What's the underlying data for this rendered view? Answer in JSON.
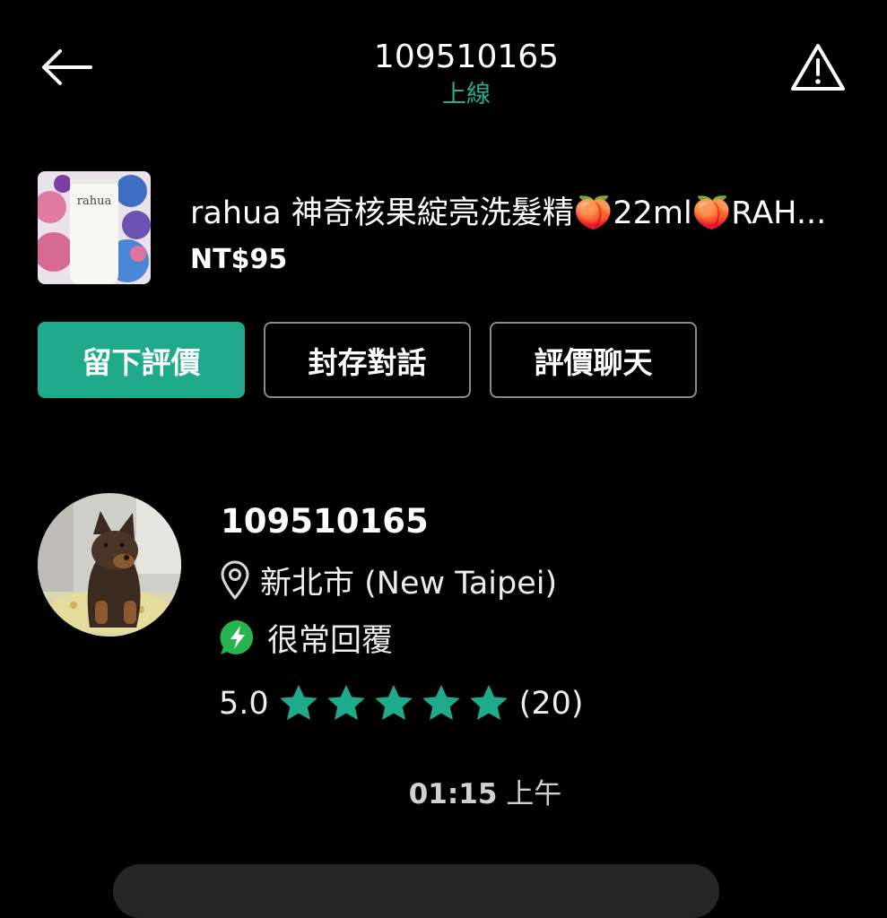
{
  "colors": {
    "accent": "#1faa8c",
    "background": "#000000",
    "outline": "#8a8a8a",
    "online_status": "#2bab8e"
  },
  "header": {
    "back_icon": "arrow-left-icon",
    "title": "109510165",
    "status": "上線",
    "report_icon": "warning-triangle-icon"
  },
  "listing": {
    "title": "rahua 神奇核果綻亮洗髮精🍑22ml🍑RAH...",
    "price": "NT$95",
    "thumbnail_brand": "rahua"
  },
  "actions": {
    "leave_review": "留下評價",
    "archive_chat": "封存對話",
    "rate_chat": "評價聊天"
  },
  "profile": {
    "name": "109510165",
    "location_icon": "map-pin-icon",
    "location": "新北市 (New Taipei)",
    "response_icon": "lightning-badge-icon",
    "response": "很常回覆",
    "rating_score": "5.0",
    "rating_stars": 5,
    "rating_count": "(20)"
  },
  "message": {
    "time": "01:15",
    "period": "上午"
  }
}
